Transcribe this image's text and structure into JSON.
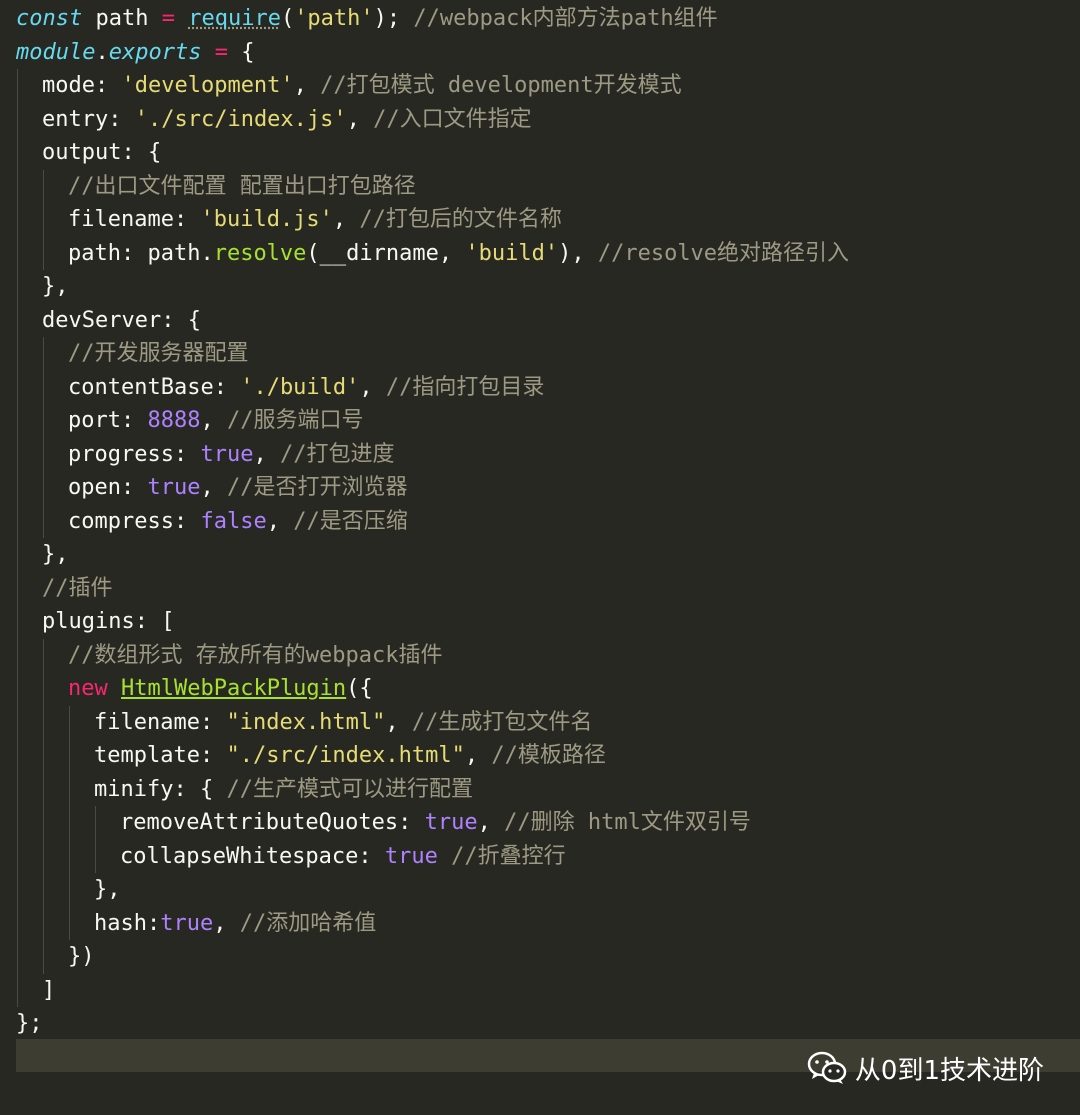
{
  "editor": {
    "lines": [
      {
        "indent": 0,
        "tokens": [
          {
            "t": "const",
            "c": "kw"
          },
          {
            "t": " path ",
            "c": "ident"
          },
          {
            "t": "=",
            "c": "op"
          },
          {
            "t": " ",
            "c": "ident"
          },
          {
            "t": "require",
            "c": "fn squiggle"
          },
          {
            "t": "(",
            "c": "punc"
          },
          {
            "t": "'path'",
            "c": "str"
          },
          {
            "t": ");",
            "c": "punc"
          },
          {
            "t": " //webpack内部方法path组件",
            "c": "cmt"
          }
        ]
      },
      {
        "indent": 0,
        "tokens": [
          {
            "t": "module",
            "c": "kw"
          },
          {
            "t": ".",
            "c": "punc"
          },
          {
            "t": "exports",
            "c": "kw"
          },
          {
            "t": " ",
            "c": "ident"
          },
          {
            "t": "=",
            "c": "op"
          },
          {
            "t": " {",
            "c": "punc"
          }
        ]
      },
      {
        "indent": 1,
        "tokens": [
          {
            "t": "mode",
            "c": "key"
          },
          {
            "t": ": ",
            "c": "punc"
          },
          {
            "t": "'development'",
            "c": "str"
          },
          {
            "t": ", ",
            "c": "punc"
          },
          {
            "t": "//打包模式 development开发模式",
            "c": "cmt"
          }
        ]
      },
      {
        "indent": 1,
        "tokens": [
          {
            "t": "entry",
            "c": "key"
          },
          {
            "t": ": ",
            "c": "punc"
          },
          {
            "t": "'./src/index.js'",
            "c": "str"
          },
          {
            "t": ", ",
            "c": "punc"
          },
          {
            "t": "//入口文件指定",
            "c": "cmt"
          }
        ]
      },
      {
        "indent": 1,
        "tokens": [
          {
            "t": "output",
            "c": "key"
          },
          {
            "t": ": {",
            "c": "punc"
          }
        ]
      },
      {
        "indent": 2,
        "tokens": [
          {
            "t": "//出口文件配置 配置出口打包路径",
            "c": "cmt"
          }
        ]
      },
      {
        "indent": 2,
        "tokens": [
          {
            "t": "filename",
            "c": "key"
          },
          {
            "t": ": ",
            "c": "punc"
          },
          {
            "t": "'build.js'",
            "c": "str"
          },
          {
            "t": ", ",
            "c": "punc"
          },
          {
            "t": "//打包后的文件名称",
            "c": "cmt"
          }
        ]
      },
      {
        "indent": 2,
        "tokens": [
          {
            "t": "path",
            "c": "key"
          },
          {
            "t": ": path.",
            "c": "punc"
          },
          {
            "t": "resolve",
            "c": "fnm"
          },
          {
            "t": "(__dirname, ",
            "c": "punc"
          },
          {
            "t": "'build'",
            "c": "str"
          },
          {
            "t": "), ",
            "c": "punc"
          },
          {
            "t": "//resolve绝对路径引入",
            "c": "cmt"
          }
        ]
      },
      {
        "indent": 1,
        "tokens": [
          {
            "t": "},",
            "c": "punc"
          }
        ]
      },
      {
        "indent": 1,
        "tokens": [
          {
            "t": "devServer",
            "c": "key"
          },
          {
            "t": ": {",
            "c": "punc"
          }
        ]
      },
      {
        "indent": 2,
        "tokens": [
          {
            "t": "//开发服务器配置",
            "c": "cmt"
          }
        ]
      },
      {
        "indent": 2,
        "tokens": [
          {
            "t": "contentBase",
            "c": "key"
          },
          {
            "t": ": ",
            "c": "punc"
          },
          {
            "t": "'./build'",
            "c": "str"
          },
          {
            "t": ", ",
            "c": "punc"
          },
          {
            "t": "//指向打包目录",
            "c": "cmt"
          }
        ]
      },
      {
        "indent": 2,
        "tokens": [
          {
            "t": "port",
            "c": "key"
          },
          {
            "t": ": ",
            "c": "punc"
          },
          {
            "t": "8888",
            "c": "num"
          },
          {
            "t": ", ",
            "c": "punc"
          },
          {
            "t": "//服务端口号",
            "c": "cmt"
          }
        ]
      },
      {
        "indent": 2,
        "tokens": [
          {
            "t": "progress",
            "c": "key"
          },
          {
            "t": ": ",
            "c": "punc"
          },
          {
            "t": "true",
            "c": "bool"
          },
          {
            "t": ", ",
            "c": "punc"
          },
          {
            "t": "//打包进度",
            "c": "cmt"
          }
        ]
      },
      {
        "indent": 2,
        "tokens": [
          {
            "t": "open",
            "c": "key"
          },
          {
            "t": ": ",
            "c": "punc"
          },
          {
            "t": "true",
            "c": "bool"
          },
          {
            "t": ", ",
            "c": "punc"
          },
          {
            "t": "//是否打开浏览器",
            "c": "cmt"
          }
        ]
      },
      {
        "indent": 2,
        "tokens": [
          {
            "t": "compress",
            "c": "key"
          },
          {
            "t": ": ",
            "c": "punc"
          },
          {
            "t": "false",
            "c": "bool"
          },
          {
            "t": ", ",
            "c": "punc"
          },
          {
            "t": "//是否压缩",
            "c": "cmt"
          }
        ]
      },
      {
        "indent": 1,
        "tokens": [
          {
            "t": "},",
            "c": "punc"
          }
        ]
      },
      {
        "indent": 1,
        "tokens": [
          {
            "t": "//插件",
            "c": "cmt"
          }
        ]
      },
      {
        "indent": 1,
        "tokens": [
          {
            "t": "plugins",
            "c": "key"
          },
          {
            "t": ": [",
            "c": "punc"
          }
        ]
      },
      {
        "indent": 2,
        "tokens": [
          {
            "t": "//数组形式 存放所有的webpack插件",
            "c": "cmt"
          }
        ]
      },
      {
        "indent": 2,
        "tokens": [
          {
            "t": "new",
            "c": "kw2"
          },
          {
            "t": " ",
            "c": "punc"
          },
          {
            "t": "HtmlWebPackPlugin",
            "c": "cls"
          },
          {
            "t": "({",
            "c": "punc"
          }
        ]
      },
      {
        "indent": 3,
        "tokens": [
          {
            "t": "filename",
            "c": "key"
          },
          {
            "t": ": ",
            "c": "punc"
          },
          {
            "t": "\"index.html\"",
            "c": "str"
          },
          {
            "t": ", ",
            "c": "punc"
          },
          {
            "t": "//生成打包文件名",
            "c": "cmt"
          }
        ]
      },
      {
        "indent": 3,
        "tokens": [
          {
            "t": "template",
            "c": "key"
          },
          {
            "t": ": ",
            "c": "punc"
          },
          {
            "t": "\"./src/index.html\"",
            "c": "str"
          },
          {
            "t": ", ",
            "c": "punc"
          },
          {
            "t": "//模板路径",
            "c": "cmt"
          }
        ]
      },
      {
        "indent": 3,
        "tokens": [
          {
            "t": "minify",
            "c": "key"
          },
          {
            "t": ": { ",
            "c": "punc"
          },
          {
            "t": "//生产模式可以进行配置",
            "c": "cmt"
          }
        ]
      },
      {
        "indent": 4,
        "tokens": [
          {
            "t": "removeAttributeQuotes",
            "c": "key"
          },
          {
            "t": ": ",
            "c": "punc"
          },
          {
            "t": "true",
            "c": "bool"
          },
          {
            "t": ", ",
            "c": "punc"
          },
          {
            "t": "//删除 html文件双引号",
            "c": "cmt"
          }
        ]
      },
      {
        "indent": 4,
        "tokens": [
          {
            "t": "collapseWhitespace",
            "c": "key"
          },
          {
            "t": ": ",
            "c": "punc"
          },
          {
            "t": "true",
            "c": "bool"
          },
          {
            "t": " ",
            "c": "punc"
          },
          {
            "t": "//折叠控行",
            "c": "cmt"
          }
        ]
      },
      {
        "indent": 3,
        "tokens": [
          {
            "t": "},",
            "c": "punc"
          }
        ]
      },
      {
        "indent": 3,
        "tokens": [
          {
            "t": "hash",
            "c": "key"
          },
          {
            "t": ":",
            "c": "punc"
          },
          {
            "t": "true",
            "c": "bool"
          },
          {
            "t": ", ",
            "c": "punc"
          },
          {
            "t": "//添加哈希值",
            "c": "cmt"
          }
        ]
      },
      {
        "indent": 2,
        "tokens": [
          {
            "t": "})",
            "c": "punc"
          }
        ]
      },
      {
        "indent": 1,
        "tokens": [
          {
            "t": "]",
            "c": "punc"
          }
        ]
      },
      {
        "indent": 0,
        "tokens": [
          {
            "t": "};",
            "c": "punc"
          }
        ]
      }
    ]
  },
  "watermark": {
    "text": "从0到1技术进阶",
    "icon": "wechat-icon"
  }
}
